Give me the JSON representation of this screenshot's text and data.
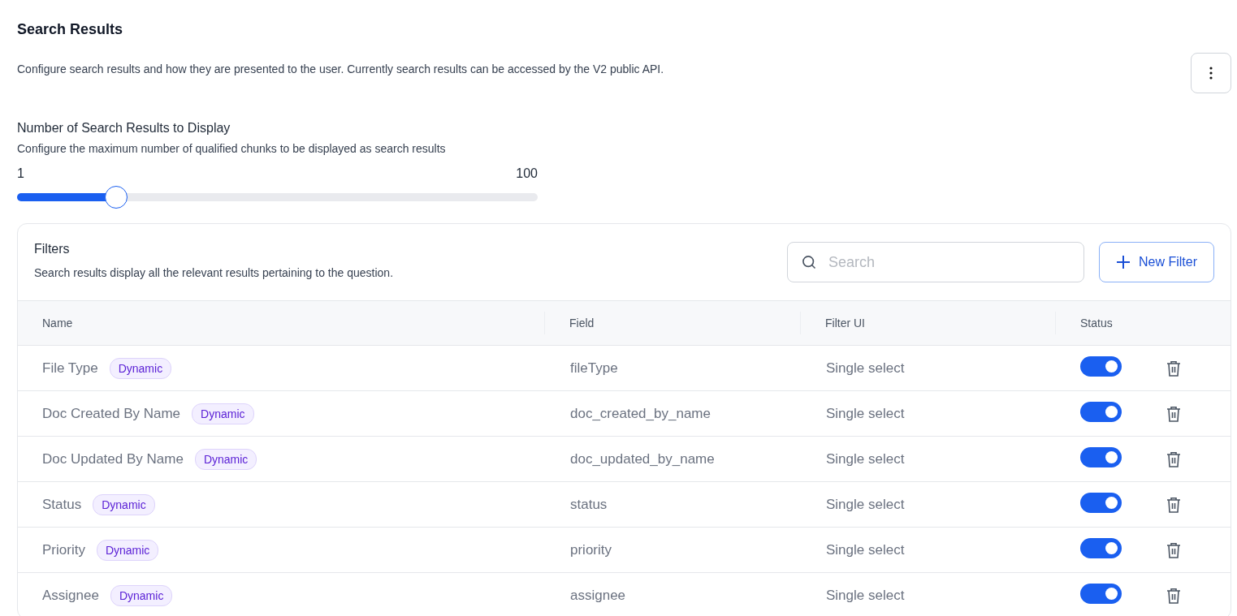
{
  "header": {
    "title": "Search Results",
    "description": "Configure search results and how they are presented to the user. Currently search results can be accessed by the V2 public API."
  },
  "results_setting": {
    "title": "Number of Search Results to Display",
    "description": "Configure the maximum number of qualified chunks to be displayed as search results",
    "min_label": "1",
    "max_label": "100",
    "level": 0.19
  },
  "filters": {
    "title": "Filters",
    "description": "Search results display all the relevant results pertaining to the question.",
    "search": {
      "placeholder": "Search"
    },
    "new_button": "New Filter",
    "columns": [
      "Name",
      "Field",
      "Filter UI",
      "Status"
    ],
    "rows": [
      {
        "name": "File Type",
        "tag": "Dynamic",
        "field": "fileType",
        "filter_ui": "Single select",
        "on": true
      },
      {
        "name": "Doc Created By Name",
        "tag": "Dynamic",
        "field": "doc_created_by_name",
        "filter_ui": "Single select",
        "on": true
      },
      {
        "name": "Doc Updated By Name",
        "tag": "Dynamic",
        "field": "doc_updated_by_name",
        "filter_ui": "Single select",
        "on": true
      },
      {
        "name": "Status",
        "tag": "Dynamic",
        "field": "status",
        "filter_ui": "Single select",
        "on": true
      },
      {
        "name": "Priority",
        "tag": "Dynamic",
        "field": "priority",
        "filter_ui": "Single select",
        "on": true
      },
      {
        "name": "Assignee",
        "tag": "Dynamic",
        "field": "assignee",
        "filter_ui": "Single select",
        "on": true
      }
    ]
  }
}
